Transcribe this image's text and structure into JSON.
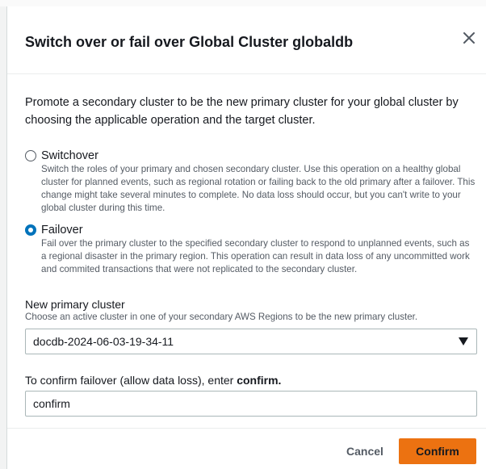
{
  "modal": {
    "title": "Switch over or fail over Global Cluster globaldb",
    "close_icon": "close-icon"
  },
  "body": {
    "intro": "Promote a secondary cluster to be the new primary cluster for your global cluster by choosing the applicable operation and the target cluster.",
    "options": [
      {
        "label": "Switchover",
        "selected": false,
        "description": "Switch the roles of your primary and chosen secondary cluster. Use this operation on a healthy global cluster for planned events, such as regional rotation or failing back to the old primary after a failover. This change might take several minutes to complete. No data loss should occur, but you can't write to your global cluster during this time."
      },
      {
        "label": "Failover",
        "selected": true,
        "description": "Fail over the primary cluster to the specified secondary cluster to respond to unplanned events, such as a regional disaster in the primary region. This operation can result in data loss of any uncommitted work and commited transactions that were not replicated to the secondary cluster."
      }
    ],
    "new_primary": {
      "label": "New primary cluster",
      "description": "Choose an active cluster in one of your secondary AWS Regions to be the new primary cluster.",
      "selected_value": "docdb-2024-06-03-19-34-11",
      "caret_icon": "caret-down-icon"
    },
    "confirm_field": {
      "label_prefix": "To confirm failover (allow data loss), enter ",
      "label_keyword": "confirm.",
      "value": "confirm"
    }
  },
  "footer": {
    "cancel_label": "Cancel",
    "confirm_label": "Confirm"
  },
  "colors": {
    "primary_button": "#ec7211",
    "radio_selected": "#0073bb",
    "text": "#16191f",
    "secondary_text": "#545b64"
  }
}
